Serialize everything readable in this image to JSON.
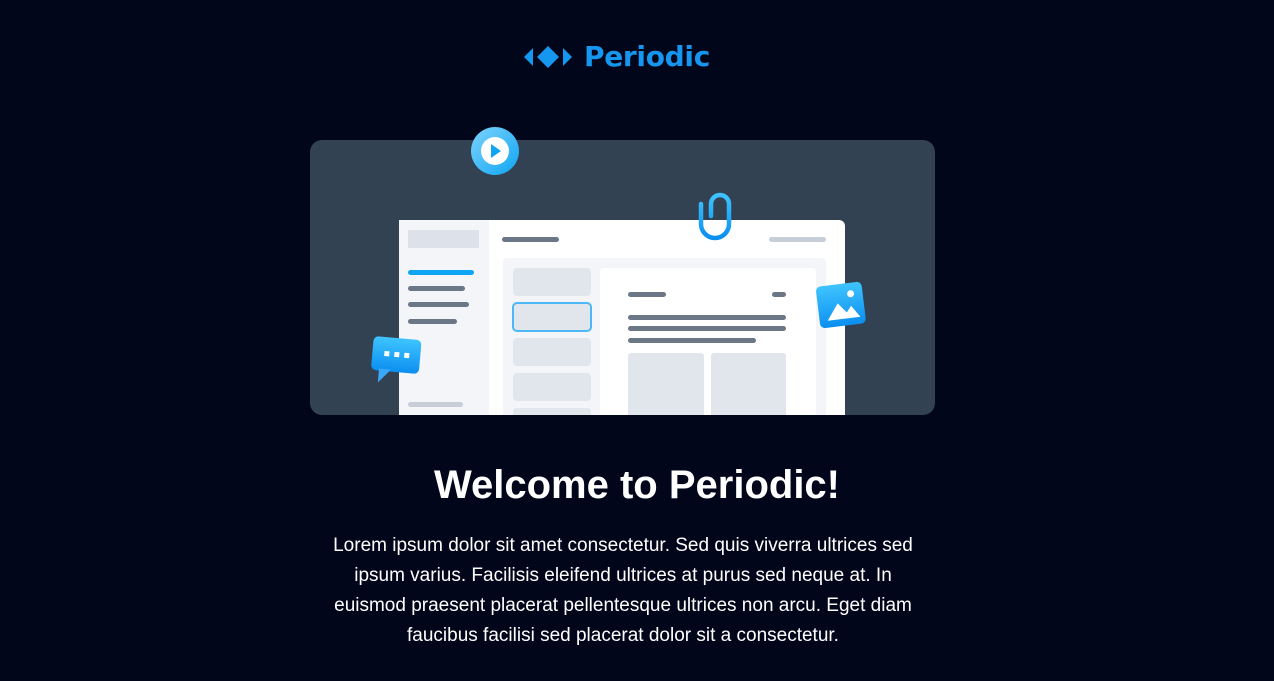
{
  "brand": {
    "name": "Periodic",
    "logo_icon": "periodic-diamond-logo",
    "color": "#1596ef"
  },
  "hero": {
    "illustration": "app-window-illustration",
    "icons": [
      "play-icon",
      "paperclip-icon",
      "image-icon",
      "chat-bubble-icon"
    ],
    "panel_color": "#334252"
  },
  "welcome": {
    "title": "Welcome to Periodic!",
    "body": "Lorem ipsum dolor sit amet consectetur. Sed quis viverra ultrices sed ipsum varius. Facilisis eleifend ultrices at purus sed neque at. In euismod praesent placerat pellentesque ultrices non arcu. Eget diam faucibus facilisi sed placerat dolor sit a consectetur."
  },
  "colors": {
    "background": "#02061a",
    "accent": "#0ea5f3"
  }
}
